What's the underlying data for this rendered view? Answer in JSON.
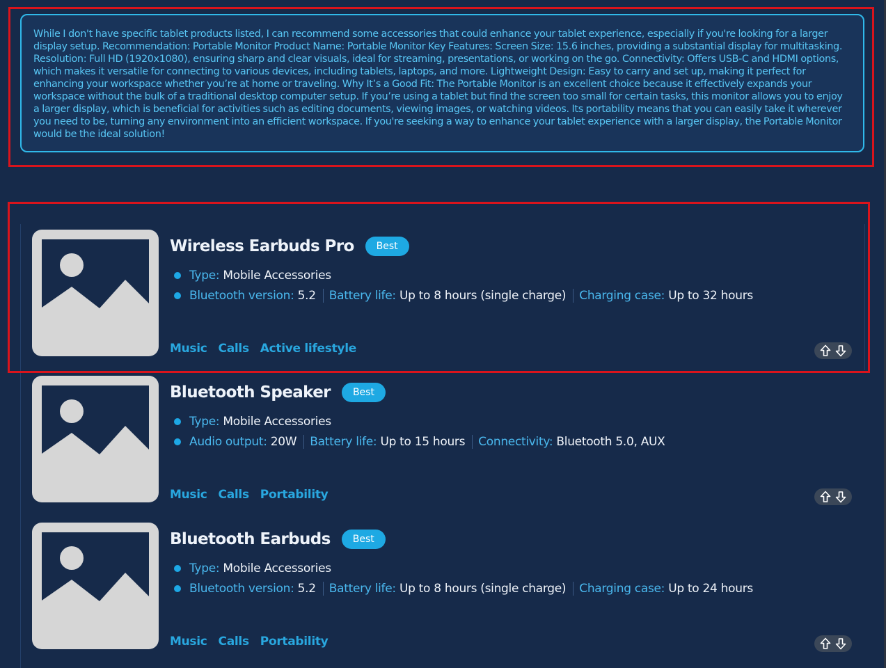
{
  "message": {
    "text": "While I don't have specific tablet products listed, I can recommend some accessories that could enhance your tablet experience, especially if you're looking for a larger display setup. Recommendation: Portable Monitor Product Name: Portable Monitor Key Features: Screen Size: 15.6 inches, providing a substantial display for multitasking. Resolution: Full HD (1920x1080), ensuring sharp and clear visuals, ideal for streaming, presentations, or working on the go. Connectivity: Offers USB-C and HDMI options, which makes it versatile for connecting to various devices, including tablets, laptops, and more. Lightweight Design: Easy to carry and set up, making it perfect for enhancing your workspace whether you’re at home or traveling. Why It’s a Good Fit: The Portable Monitor is an excellent choice because it effectively expands your workspace without the bulk of a traditional desktop computer setup. If you’re using a tablet but find the screen too small for certain tasks, this monitor allows you to enjoy a larger display, which is beneficial for activities such as editing documents, viewing images, or watching videos. Its portability means that you can easily take it wherever you need to be, turning any environment into an efficient workspace. If you're seeking a way to enhance your tablet experience with a larger display, the Portable Monitor would be the ideal solution!"
  },
  "colors": {
    "background": "#162a4a",
    "accent": "#1ea9e3",
    "highlight": "#d9141c",
    "message_border": "#30b9ea"
  },
  "products": [
    {
      "title": "Wireless Earbuds Pro",
      "badge": "Best",
      "image_icon": "image-placeholder-icon",
      "type_label": "Type:",
      "type_value": "Mobile Accessories",
      "specs": [
        {
          "label": "Bluetooth version:",
          "value": "5.2"
        },
        {
          "label": "Battery life:",
          "value": "Up to 8 hours (single charge)"
        },
        {
          "label": "Charging case:",
          "value": "Up to 32 hours"
        }
      ],
      "tags": [
        "Music",
        "Calls",
        "Active lifestyle"
      ]
    },
    {
      "title": "Bluetooth Speaker",
      "badge": "Best",
      "image_icon": "image-placeholder-icon",
      "type_label": "Type:",
      "type_value": "Mobile Accessories",
      "specs": [
        {
          "label": "Audio output:",
          "value": "20W"
        },
        {
          "label": "Battery life:",
          "value": "Up to 15 hours"
        },
        {
          "label": "Connectivity:",
          "value": "Bluetooth 5.0, AUX"
        }
      ],
      "tags": [
        "Music",
        "Calls",
        "Portability"
      ]
    },
    {
      "title": "Bluetooth Earbuds",
      "badge": "Best",
      "image_icon": "image-placeholder-icon",
      "type_label": "Type:",
      "type_value": "Mobile Accessories",
      "specs": [
        {
          "label": "Bluetooth version:",
          "value": "5.2"
        },
        {
          "label": "Battery life:",
          "value": "Up to 8 hours (single charge)"
        },
        {
          "label": "Charging case:",
          "value": "Up to 24 hours"
        }
      ],
      "tags": [
        "Music",
        "Calls",
        "Portability"
      ]
    }
  ]
}
